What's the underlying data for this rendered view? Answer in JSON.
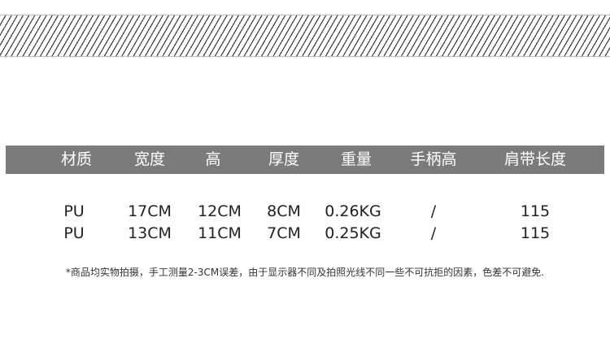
{
  "table": {
    "headers": [
      "材质",
      "宽度",
      "高",
      "厚度",
      "重量",
      "手柄高",
      "肩带长度"
    ],
    "rows": [
      [
        "PU",
        "17CM",
        "12CM",
        "8CM",
        "0.26KG",
        "/",
        "115"
      ],
      [
        "PU",
        "13CM",
        "11CM",
        "7CM",
        "0.25KG",
        "/",
        "115"
      ]
    ]
  },
  "note": "*商品均实物拍摄，手工测量2-3CM误差，由于显示器不同及拍照光线不同一些不可抗拒的因素，色差不可避免.",
  "colors": {
    "header_background": "#7b7b7b",
    "header_text": "#ffffff",
    "body_text": "#222222",
    "hatch_stroke": "#3a3a3a"
  }
}
